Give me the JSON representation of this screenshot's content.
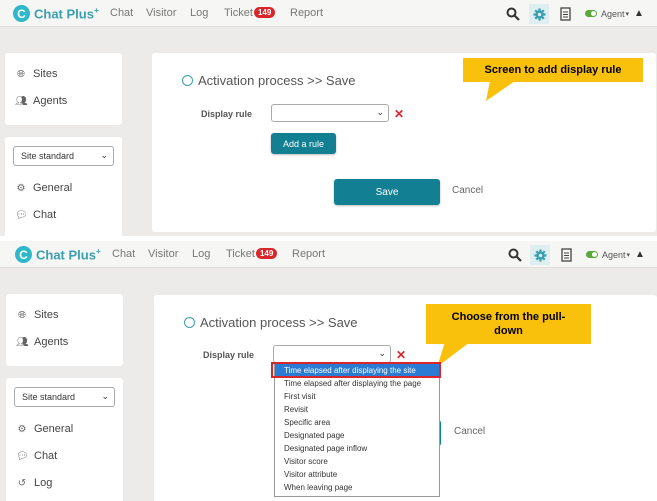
{
  "app": {
    "logo_text": "Chat Plus",
    "logo_sup": "+",
    "nav": [
      "Chat",
      "Visitor",
      "Log",
      "Ticket",
      "Report"
    ],
    "ticket_badge": "149",
    "agent_label": "Agent",
    "icons": [
      "search-icon",
      "gear-icon",
      "document-icon",
      "toggle-icon",
      "warning-icon"
    ]
  },
  "sidebar": {
    "top_items": [
      "Sites",
      "Agents"
    ],
    "site_select": "Site standard",
    "items_panel1": [
      "General",
      "Chat"
    ],
    "items_panel2": [
      "General",
      "Chat",
      "Log"
    ]
  },
  "main": {
    "title": "Activation process >> Save",
    "display_rule_label": "Display rule",
    "add_rule_button": "Add a rule",
    "save_button": "Save",
    "cancel_link": "Cancel"
  },
  "callouts": {
    "screen1": "Screen to add display rule",
    "screen2": "Choose from the pull-down"
  },
  "dropdown": {
    "selected": "Time elapsed after displaying the site",
    "options": [
      "Time elapsed after displaying the site",
      "Time elapsed after displaying the page",
      "First visit",
      "Revisit",
      "Specific area",
      "Designated page",
      "Designated page inflow",
      "Visitor score",
      "Visitor attribute",
      "When leaving page"
    ]
  },
  "colors": {
    "accent_teal": "#137f93",
    "logo_teal": "#2eb8c9",
    "badge_red": "#d9262b",
    "callout_yellow": "#f9c00c",
    "dropdown_selected": "#2a7bd3"
  }
}
